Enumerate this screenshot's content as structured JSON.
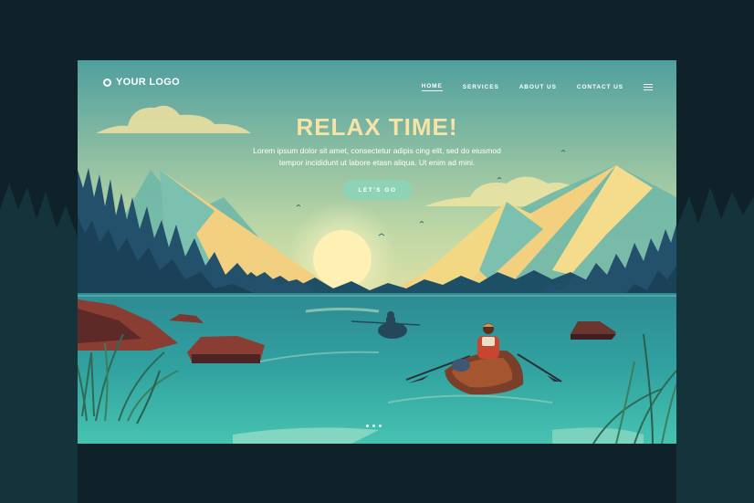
{
  "logo": {
    "text": "YOUR LOGO",
    "icon": "ring-icon"
  },
  "nav": {
    "home": "HOME",
    "services": "SERVICES",
    "about": "ABOUT US",
    "contact": "CONTACT US",
    "menu_icon": "hamburger-menu-icon"
  },
  "hero": {
    "title": "RELAX TIME!",
    "line1": "Lorem ipsum dolor sit amet, consectetur adipis cing elit, sed do eiusmod",
    "line2": "tempor incididunt ut labore etasn aliqua. Ut enim ad mini.",
    "cta": "LET'S GO"
  },
  "carousel": {
    "slides": 3,
    "active_index": 0
  },
  "colors": {
    "page_background": "#0f2229",
    "sky_top": "#5aa9a4",
    "sky_bottom": "#f3e6a3",
    "title": "#f5e4a8",
    "cta_button": "#8ed3b5",
    "water": "#2f9a9b",
    "boat": "#7a3f2a"
  }
}
